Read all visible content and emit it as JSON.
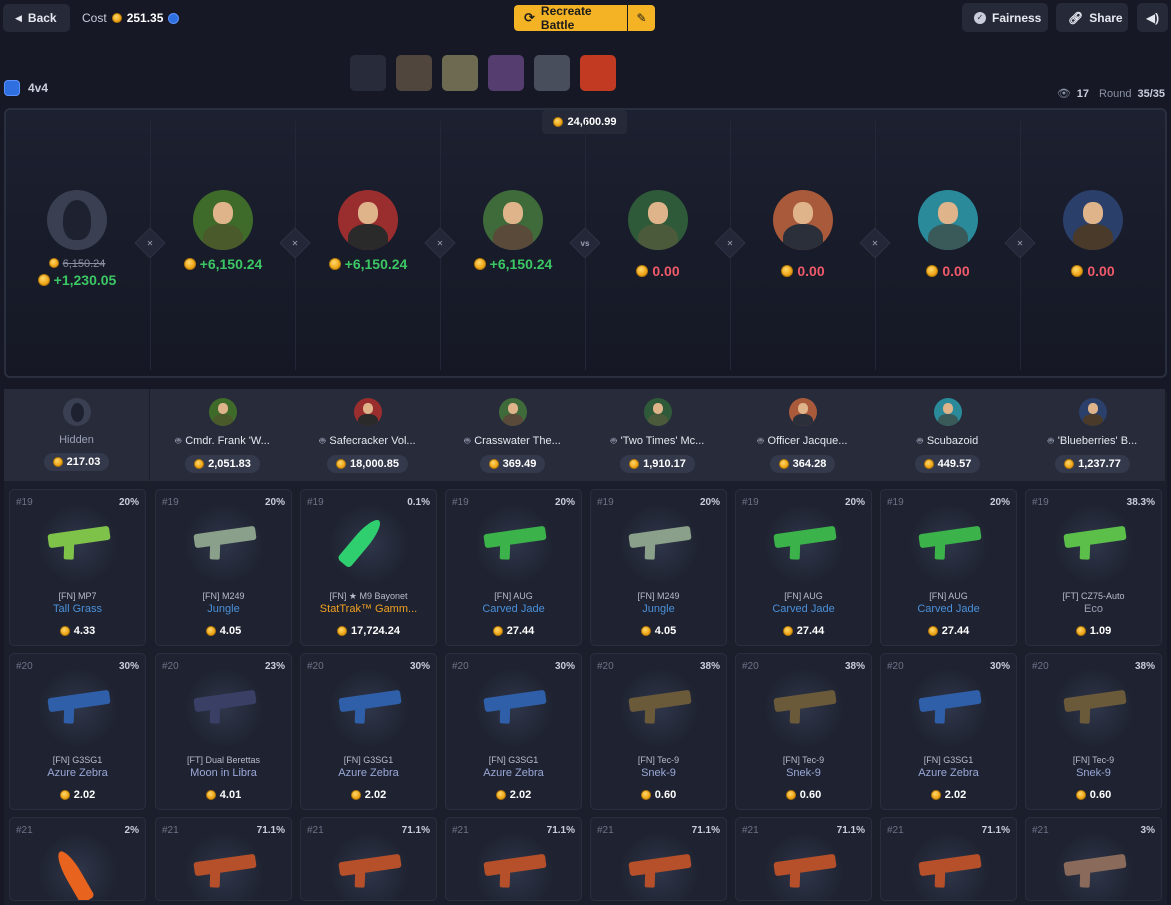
{
  "topbar": {
    "back_label": "Back",
    "cost_label": "Cost",
    "cost_value": "251.35",
    "recreate_label": "Recreate Battle",
    "fairness_label": "Fairness",
    "share_label": "Share"
  },
  "battle": {
    "mode": "4v4",
    "viewers": "17",
    "round_label": "Round",
    "round_value": "35/35",
    "pot": "24,600.99"
  },
  "players": [
    {
      "strike": "6,150.24",
      "amount": "+1,230.05",
      "result": "win",
      "name": "Hidden",
      "total": "217.03",
      "bot": false
    },
    {
      "amount": "+6,150.24",
      "result": "win",
      "name": "Cmdr. Frank 'W...",
      "total": "2,051.83",
      "bot": true
    },
    {
      "amount": "+6,150.24",
      "result": "win",
      "name": "Safecracker Vol...",
      "total": "18,000.85",
      "bot": true
    },
    {
      "amount": "+6,150.24",
      "result": "win",
      "name": "Crasswater The...",
      "total": "369.49",
      "bot": true
    },
    {
      "amount": "0.00",
      "result": "lose",
      "name": "'Two Times' Mc...",
      "total": "1,910.17",
      "bot": true
    },
    {
      "amount": "0.00",
      "result": "lose",
      "name": "Officer Jacque...",
      "total": "364.28",
      "bot": true
    },
    {
      "amount": "0.00",
      "result": "lose",
      "name": "Scubazoid",
      "total": "449.57",
      "bot": true
    },
    {
      "amount": "0.00",
      "result": "lose",
      "name": "'Blueberries' B...",
      "total": "1,237.77",
      "bot": true
    }
  ],
  "separators": [
    "",
    "",
    "",
    "vs",
    "",
    "",
    ""
  ],
  "rows": [
    {
      "round": "#19",
      "items": [
        {
          "pct": "20%",
          "name": "[FN] MP7",
          "skin": "Tall Grass",
          "price": "4.33",
          "skin_color": "#4a90d9",
          "gun_color": "#7fc24a"
        },
        {
          "pct": "20%",
          "name": "[FN] M249",
          "skin": "Jungle",
          "price": "4.05",
          "skin_color": "#4a90d9",
          "gun_color": "#8aa08a"
        },
        {
          "pct": "0.1%",
          "name": "[FN] ★ M9 Bayonet",
          "skin": "StatTrak™ Gamm...",
          "price": "17,724.24",
          "skin_color": "#f0a020",
          "gun_color": "#2fcf70"
        },
        {
          "pct": "20%",
          "name": "[FN] AUG",
          "skin": "Carved Jade",
          "price": "27.44",
          "skin_color": "#4a90d9",
          "gun_color": "#3bb24a"
        },
        {
          "pct": "20%",
          "name": "[FN] M249",
          "skin": "Jungle",
          "price": "4.05",
          "skin_color": "#4a90d9",
          "gun_color": "#8aa08a"
        },
        {
          "pct": "20%",
          "name": "[FN] AUG",
          "skin": "Carved Jade",
          "price": "27.44",
          "skin_color": "#4a90d9",
          "gun_color": "#3bb24a"
        },
        {
          "pct": "20%",
          "name": "[FN] AUG",
          "skin": "Carved Jade",
          "price": "27.44",
          "skin_color": "#4a90d9",
          "gun_color": "#3bb24a"
        },
        {
          "pct": "38.3%",
          "name": "[FT] CZ75-Auto",
          "skin": "Eco",
          "price": "1.09",
          "skin_color": "#9aa0b5",
          "gun_color": "#5cbf4a"
        }
      ]
    },
    {
      "round": "#20",
      "items": [
        {
          "pct": "30%",
          "name": "[FN] G3SG1",
          "skin": "Azure Zebra",
          "price": "2.02",
          "skin_color": "#9aa8d8",
          "gun_color": "#2f5fa8"
        },
        {
          "pct": "23%",
          "name": "[FT] Dual Berettas",
          "skin": "Moon in Libra",
          "price": "4.01",
          "skin_color": "#9aa8d8",
          "gun_color": "#3a3f66"
        },
        {
          "pct": "30%",
          "name": "[FN] G3SG1",
          "skin": "Azure Zebra",
          "price": "2.02",
          "skin_color": "#9aa8d8",
          "gun_color": "#2f5fa8"
        },
        {
          "pct": "30%",
          "name": "[FN] G3SG1",
          "skin": "Azure Zebra",
          "price": "2.02",
          "skin_color": "#9aa8d8",
          "gun_color": "#2f5fa8"
        },
        {
          "pct": "38%",
          "name": "[FN] Tec-9",
          "skin": "Snek-9",
          "price": "0.60",
          "skin_color": "#9aa8d8",
          "gun_color": "#6b5a3a"
        },
        {
          "pct": "38%",
          "name": "[FN] Tec-9",
          "skin": "Snek-9",
          "price": "0.60",
          "skin_color": "#9aa8d8",
          "gun_color": "#6b5a3a"
        },
        {
          "pct": "30%",
          "name": "[FN] G3SG1",
          "skin": "Azure Zebra",
          "price": "2.02",
          "skin_color": "#9aa8d8",
          "gun_color": "#2f5fa8"
        },
        {
          "pct": "38%",
          "name": "[FN] Tec-9",
          "skin": "Snek-9",
          "price": "0.60",
          "skin_color": "#9aa8d8",
          "gun_color": "#6b5a3a"
        }
      ]
    },
    {
      "round": "#21",
      "items": [
        {
          "pct": "2%",
          "gun_color": "#e8641e"
        },
        {
          "pct": "71.1%",
          "gun_color": "#b5502a"
        },
        {
          "pct": "71.1%",
          "gun_color": "#b5502a"
        },
        {
          "pct": "71.1%",
          "gun_color": "#b5502a"
        },
        {
          "pct": "71.1%",
          "gun_color": "#b5502a"
        },
        {
          "pct": "71.1%",
          "gun_color": "#b5502a"
        },
        {
          "pct": "71.1%",
          "gun_color": "#b5502a"
        },
        {
          "pct": "3%",
          "gun_color": "#8a6a5a"
        }
      ]
    }
  ],
  "icons": {
    "back": "chevron-left-icon",
    "coin": "coin-icon",
    "gem": "gem-icon",
    "recreate": "refresh-icon",
    "edit": "pencil-icon",
    "fairness": "check-circle-icon",
    "share": "link-icon",
    "sound": "speaker-icon",
    "viewers": "eye-icon",
    "bot": "bot-icon"
  },
  "colors": {
    "accent": "#f4b324",
    "win": "#3cc765",
    "lose": "#f05a6a",
    "background": "#161925"
  }
}
